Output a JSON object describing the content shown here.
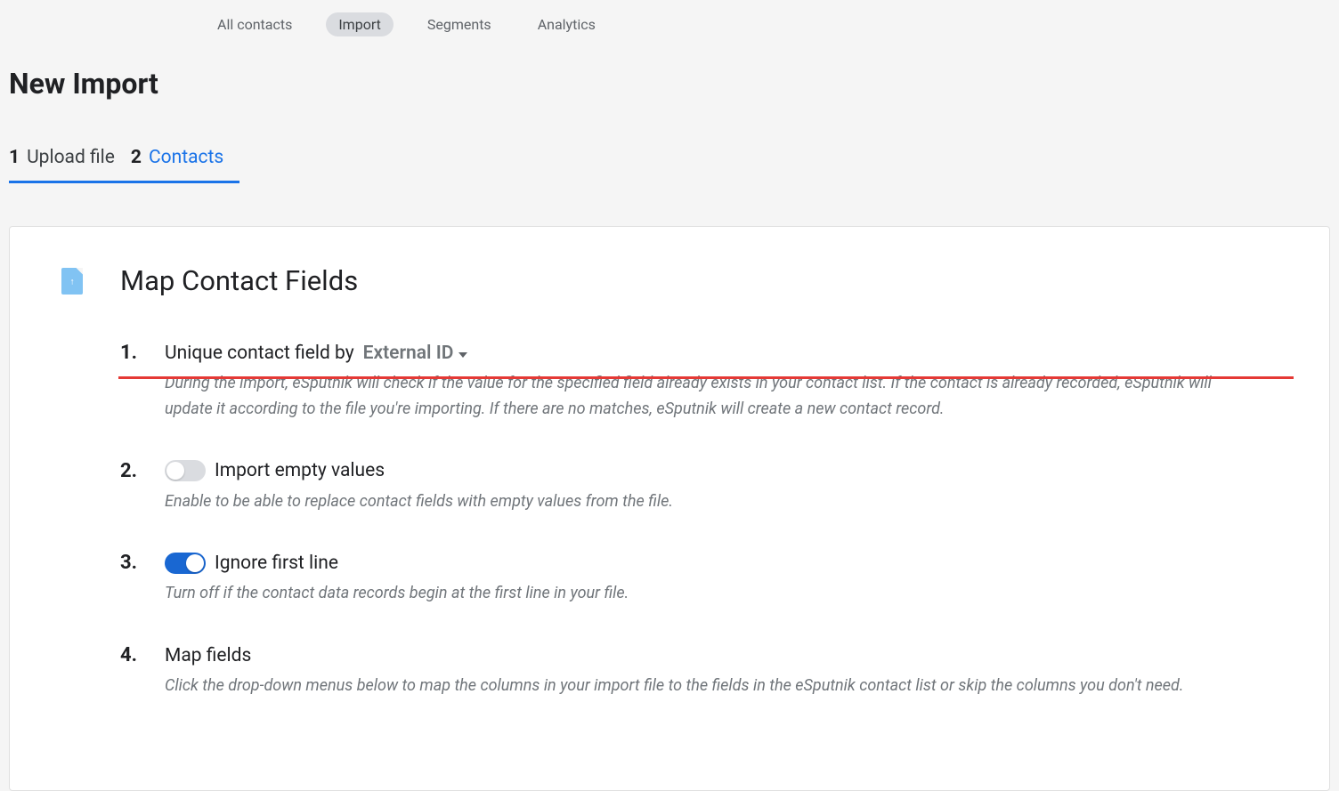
{
  "nav": {
    "items": [
      {
        "label": "All contacts",
        "active": false
      },
      {
        "label": "Import",
        "active": true
      },
      {
        "label": "Segments",
        "active": false
      },
      {
        "label": "Analytics",
        "active": false
      }
    ]
  },
  "page": {
    "title": "New Import"
  },
  "steps": [
    {
      "num": "1",
      "label": "Upload file",
      "state": "completed"
    },
    {
      "num": "2",
      "label": "Contacts",
      "state": "active"
    }
  ],
  "card": {
    "title": "Map Contact Fields",
    "items": [
      {
        "num": "1.",
        "label_prefix": "Unique contact field by",
        "dropdown_value": "External ID",
        "has_dropdown": true,
        "highlighted": true,
        "desc": "During the import, eSputnik will check if the value for the specified field already exists in your contact list. If the contact is already recorded, eSputnik will update it according to the file you're importing. If there are no matches, eSputnik will create a new contact record."
      },
      {
        "num": "2.",
        "label": "Import empty values",
        "toggle": false,
        "desc": "Enable to be able to replace contact fields with empty values from the file."
      },
      {
        "num": "3.",
        "label": "Ignore first line",
        "toggle": true,
        "desc": "Turn off if the contact data records begin at the first line in your file."
      },
      {
        "num": "4.",
        "label": "Map fields",
        "desc": "Click the drop-down menus below to map the columns in your import file to the fields in the eSputnik contact list or skip the columns you don't need."
      }
    ]
  }
}
